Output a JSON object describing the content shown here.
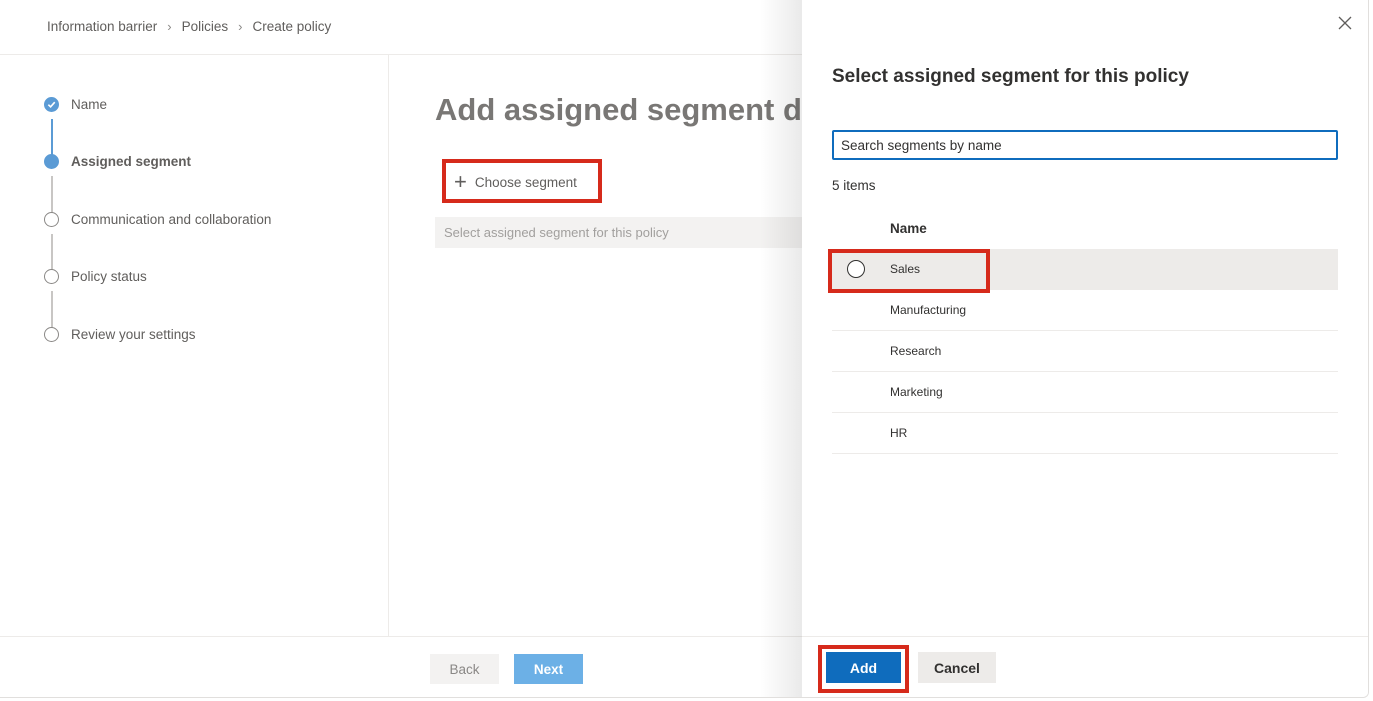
{
  "breadcrumb": [
    "Information barrier",
    "Policies",
    "Create policy"
  ],
  "steps": [
    {
      "label": "Name",
      "state": "done"
    },
    {
      "label": "Assigned segment",
      "state": "current"
    },
    {
      "label": "Communication and collaboration",
      "state": "pending"
    },
    {
      "label": "Policy status",
      "state": "pending"
    },
    {
      "label": "Review your settings",
      "state": "pending"
    }
  ],
  "main": {
    "title": "Add assigned segment details",
    "choose_segment_label": "Choose segment",
    "segment_placeholder": "Select assigned segment for this policy"
  },
  "footer": {
    "back_label": "Back",
    "next_label": "Next"
  },
  "panel": {
    "title": "Select assigned segment for this policy",
    "search_placeholder": "Search segments by name",
    "item_count": "5 items",
    "column_name": "Name",
    "segments": [
      "Sales",
      "Manufacturing",
      "Research",
      "Marketing",
      "HR"
    ],
    "add_label": "Add",
    "cancel_label": "Cancel",
    "close_icon": "close-icon"
  },
  "colors": {
    "accent": "#0f6cbd",
    "step_active": "#5b9bd5",
    "highlight": "#d62a1b"
  }
}
